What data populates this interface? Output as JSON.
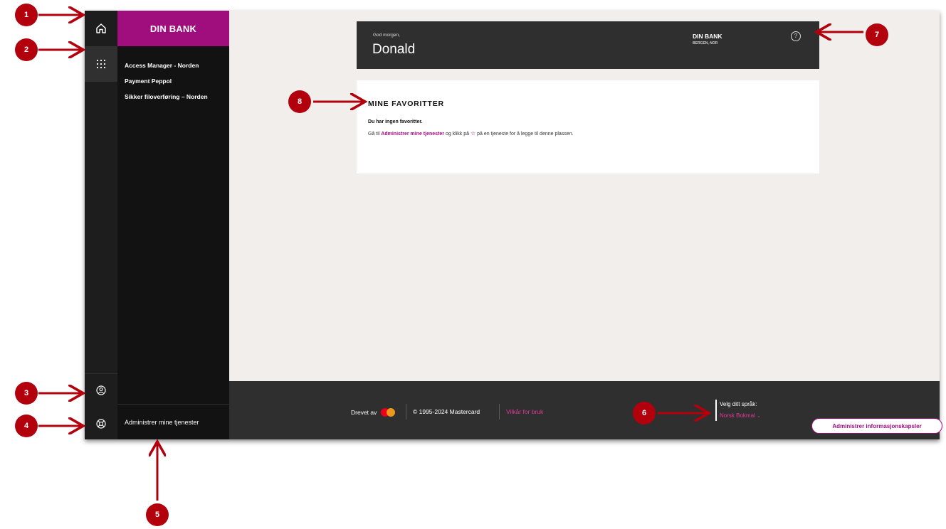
{
  "sidebar": {
    "brand": "DIN BANK",
    "menu": [
      "Access Manager - Norden",
      "Payment Peppol",
      "Sikker filoverføring – Norden"
    ],
    "manage_services": "Administrer mine tjenester"
  },
  "header": {
    "greeting": "God morgen,",
    "user_name": "Donald",
    "bank_name": "DIN BANK",
    "bank_location": "BERGEN, NOR",
    "help_symbol": "?"
  },
  "favorites": {
    "title": "MINE FAVORITTER",
    "empty_message": "Du har ingen favoritter.",
    "hint_prefix": "Gå til",
    "hint_link": "Administrer mine tjenester",
    "hint_mid": "og klikk på",
    "hint_suffix": "på en tjeneste for å legge til denne plassen."
  },
  "footer": {
    "powered_by": "Drevet av",
    "copyright": "© 1995-2024 Mastercard",
    "terms": "Vilkår for bruk",
    "language_label": "Velg ditt språk:",
    "language_value": "Norsk Bokmal"
  },
  "cookie_button": "Administrer informasjonskapsler",
  "annotations": [
    "1",
    "2",
    "3",
    "4",
    "5",
    "6",
    "7",
    "8"
  ],
  "icons": {
    "home": "home-icon",
    "apps": "grid-icon",
    "user": "user-circle-icon",
    "help": "lifebuoy-icon",
    "star": "star-icon",
    "chevron": "chevron-down-icon"
  },
  "colors": {
    "brand": "#a00d7c",
    "accent_link": "#e0379a",
    "annotation": "#b3000d",
    "dark": "#1d1d1d"
  }
}
